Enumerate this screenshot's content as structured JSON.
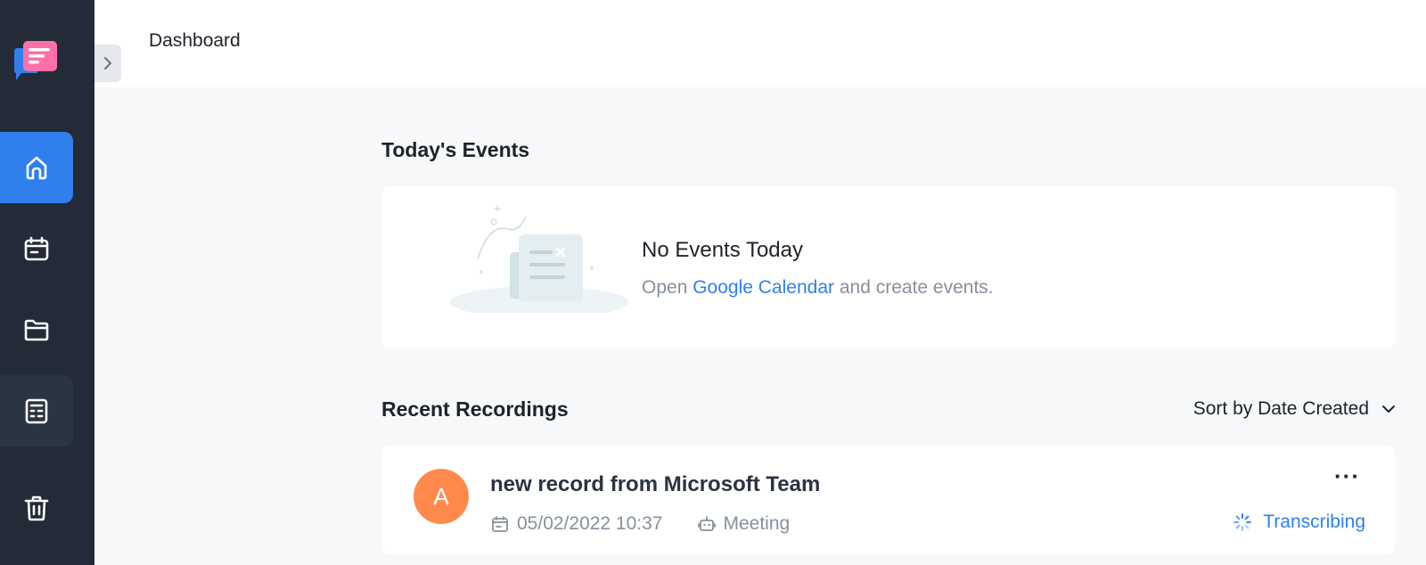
{
  "header": {
    "title": "Dashboard"
  },
  "sidebar": {
    "items": [
      {
        "name": "home",
        "icon": "home-icon",
        "active": true
      },
      {
        "name": "calendar",
        "icon": "calendar-icon",
        "active": false
      },
      {
        "name": "folder",
        "icon": "folder-icon",
        "active": false
      },
      {
        "name": "notes",
        "icon": "notes-icon",
        "active": false
      },
      {
        "name": "trash",
        "icon": "trash-icon",
        "active": false
      }
    ]
  },
  "events": {
    "section_title": "Today's Events",
    "empty_title": "No Events Today",
    "empty_prefix": "Open",
    "empty_link": "Google Calendar",
    "empty_suffix": "and create events."
  },
  "recordings": {
    "section_title": "Recent Recordings",
    "sort_label": "Sort by Date Created",
    "items": [
      {
        "avatar": "A",
        "title": "new record from Microsoft Team",
        "date": "05/02/2022 10:37",
        "type": "Meeting",
        "status": "Transcribing",
        "more": "···"
      }
    ]
  },
  "colors": {
    "sidebar_bg": "#232b38",
    "accent": "#2f80ed",
    "avatar": "#ff8a4c"
  }
}
